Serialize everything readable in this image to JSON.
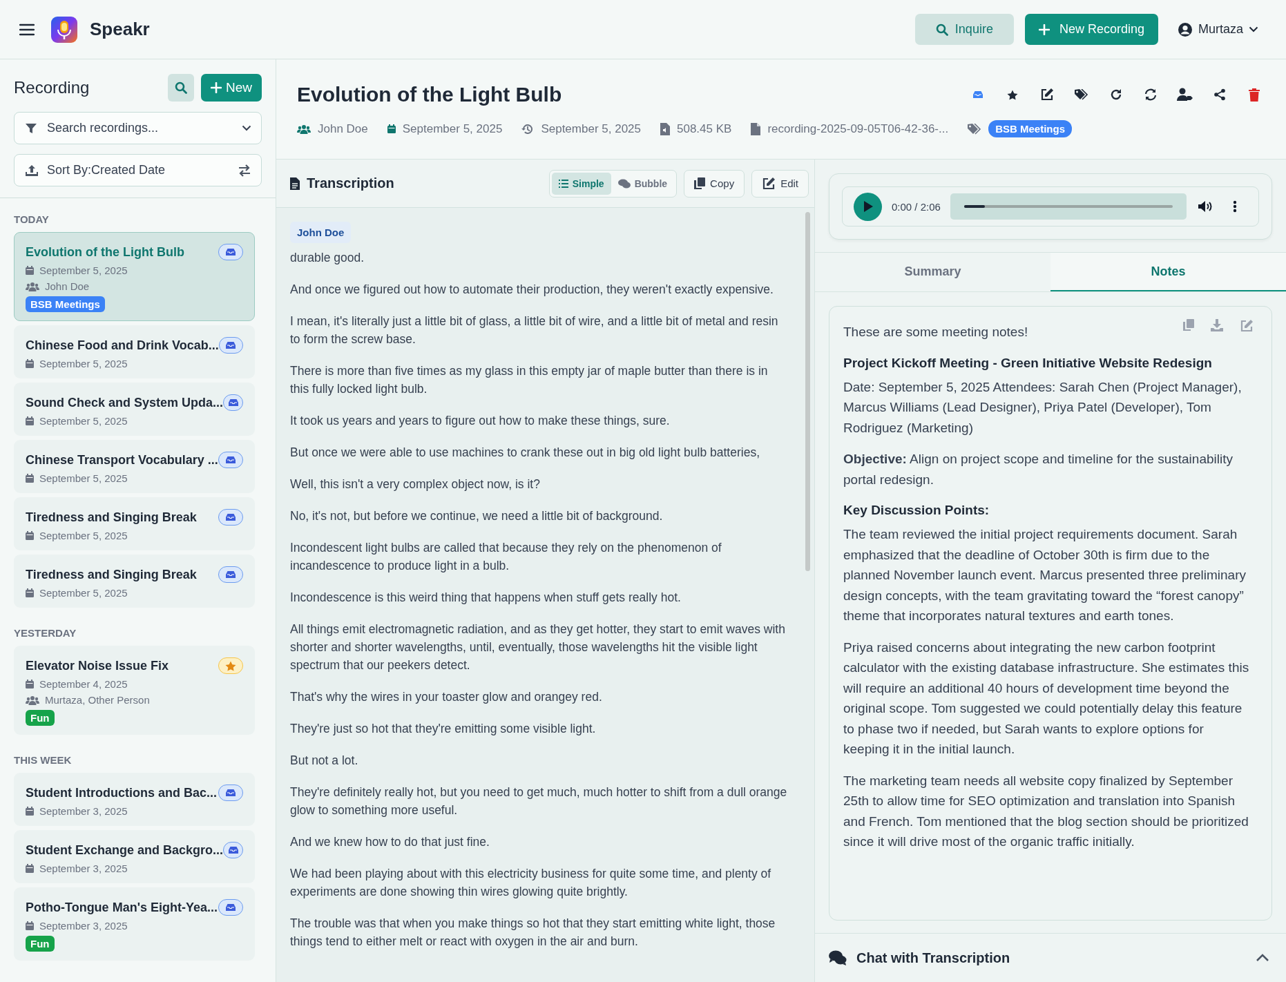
{
  "header": {
    "app_name": "Speakr",
    "inquire": "Inquire",
    "new_recording": "New Recording",
    "user": "Murtaza"
  },
  "sidebar": {
    "title": "Recording",
    "new_button": "New",
    "search_placeholder": "Search recordings...",
    "sort": "Sort By:Created Date",
    "groups": [
      {
        "label": "TODAY",
        "items": [
          {
            "title": "Evolution of the Light Bulb",
            "date": "September 5, 2025",
            "participants": "John Doe",
            "tag": {
              "label": "BSB Meetings",
              "color": "#3b82f6"
            },
            "selected": true,
            "starred": false
          },
          {
            "title": "Chinese Food and Drink Vocab...",
            "date": "September 5, 2025",
            "selected": false,
            "starred": false
          },
          {
            "title": "Sound Check and System Upda...",
            "date": "September 5, 2025",
            "selected": false,
            "starred": false
          },
          {
            "title": "Chinese Transport Vocabulary ...",
            "date": "September 5, 2025",
            "selected": false,
            "starred": false
          },
          {
            "title": "Tiredness and Singing Break",
            "date": "September 5, 2025",
            "selected": false,
            "starred": false
          },
          {
            "title": "Tiredness and Singing Break",
            "date": "September 5, 2025",
            "selected": false,
            "starred": false
          }
        ]
      },
      {
        "label": "YESTERDAY",
        "items": [
          {
            "title": "Elevator Noise Issue Fix",
            "date": "September 4, 2025",
            "participants": "Murtaza, Other Person",
            "tag": {
              "label": "Fun",
              "color": "#16a34a"
            },
            "selected": false,
            "starred": true
          }
        ]
      },
      {
        "label": "THIS WEEK",
        "items": [
          {
            "title": "Student Introductions and Bac...",
            "date": "September 3, 2025",
            "selected": false,
            "starred": false
          },
          {
            "title": "Student Exchange and Backgro...",
            "date": "September 3, 2025",
            "selected": false,
            "starred": false
          },
          {
            "title": "Potho-Tongue Man's Eight-Yea...",
            "date": "September 3, 2025",
            "tag": {
              "label": "Fun",
              "color": "#16a34a"
            },
            "selected": false,
            "starred": false
          }
        ]
      }
    ]
  },
  "recording": {
    "title": "Evolution of the Light Bulb",
    "participants": "John Doe",
    "created": "September 5, 2025",
    "updated": "September 5, 2025",
    "size": "508.45 KB",
    "filename": "recording-2025-09-05T06-42-36-...",
    "tag": {
      "label": "BSB Meetings",
      "color": "#3b82f6"
    }
  },
  "transcription": {
    "title": "Transcription",
    "view_modes": [
      {
        "label": "Simple",
        "selected": true
      },
      {
        "label": "Bubble",
        "selected": false
      }
    ],
    "copy": "Copy",
    "edit": "Edit",
    "speaker": "John Doe",
    "paragraphs": [
      "durable good.",
      "And once we figured out how to automate their production, they weren't exactly expensive.",
      "I mean, it's literally just a little bit of glass, a little bit of wire, and a little bit of metal and resin to form the screw base.",
      "There is more than five times as my glass in this empty jar of maple butter than there is in this fully locked light bulb.",
      "It took us years and years to figure out how to make these things, sure.",
      "But once we were able to use machines to crank these out in big old light bulb batteries,",
      "Well, this isn't a very complex object now, is it?",
      "No, it's not, but before we continue, we need a little bit of background.",
      "Incondescent light bulbs are called that because they rely on the phenomenon of incandescence to produce light in a bulb.",
      "Incondescence is this weird thing that happens when stuff gets really hot.",
      "All things emit electromagnetic radiation, and as they get hotter, they start to emit waves with shorter and shorter wavelengths, until, eventually, those wavelengths hit the visible light spectrum that our peekers detect.",
      "That's why the wires in your toaster glow and orangey red.",
      "They're just so hot that they're emitting some visible light.",
      "But not a lot.",
      "They're definitely really hot, but you need to get much, much hotter to shift from a dull orange glow to something more useful.",
      "And we knew how to do that just fine.",
      "We had been playing about with this electricity business for quite some time, and plenty of experiments are done showing thin wires glowing quite brightly.",
      "The trouble was that when you make things so hot that they start emitting white light, those things tend to either melt or react with oxygen in the air and burn."
    ]
  },
  "player": {
    "time": "0:00 / 2:06",
    "level": 0.1
  },
  "tabs": [
    {
      "label": "Summary",
      "selected": false
    },
    {
      "label": "Notes",
      "selected": true
    }
  ],
  "notes": [
    {
      "kind": "paragraph",
      "text": "These are some meeting notes!"
    },
    {
      "kind": "heading",
      "text": "Project Kickoff Meeting - Green Initiative Website Redesign"
    },
    {
      "kind": "paragraph",
      "text": "Date: September 5, 2025 Attendees: Sarah Chen (Project Manager), Marcus Williams (Lead Designer), Priya Patel (Developer), Tom Rodriguez (Marketing)"
    },
    {
      "kind": "paragraph",
      "text": "**Objective:** Align on project scope and timeline for the sustainability portal redesign."
    },
    {
      "kind": "heading",
      "text": "Key Discussion Points:"
    },
    {
      "kind": "paragraph",
      "text": "The team reviewed the initial project requirements document. Sarah emphasized that the deadline of October 30th is firm due to the planned November launch event. Marcus presented three preliminary design concepts, with the team gravitating toward the “forest canopy” theme that incorporates natural textures and earth tones."
    },
    {
      "kind": "paragraph",
      "text": "Priya raised concerns about integrating the new carbon footprint calculator with the existing database infrastructure. She estimates this will require an additional 40 hours of development time beyond the original scope. Tom suggested we could potentially delay this feature to phase two if needed, but Sarah wants to explore options for keeping it in the initial launch."
    },
    {
      "kind": "paragraph",
      "text": "The marketing team needs all website copy finalized by September 25th to allow time for SEO optimization and translation into Spanish and French. Tom mentioned that the blog section should be prioritized since it will drive most of the organic traffic initially."
    }
  ],
  "chat": {
    "title": "Chat with Transcription"
  }
}
